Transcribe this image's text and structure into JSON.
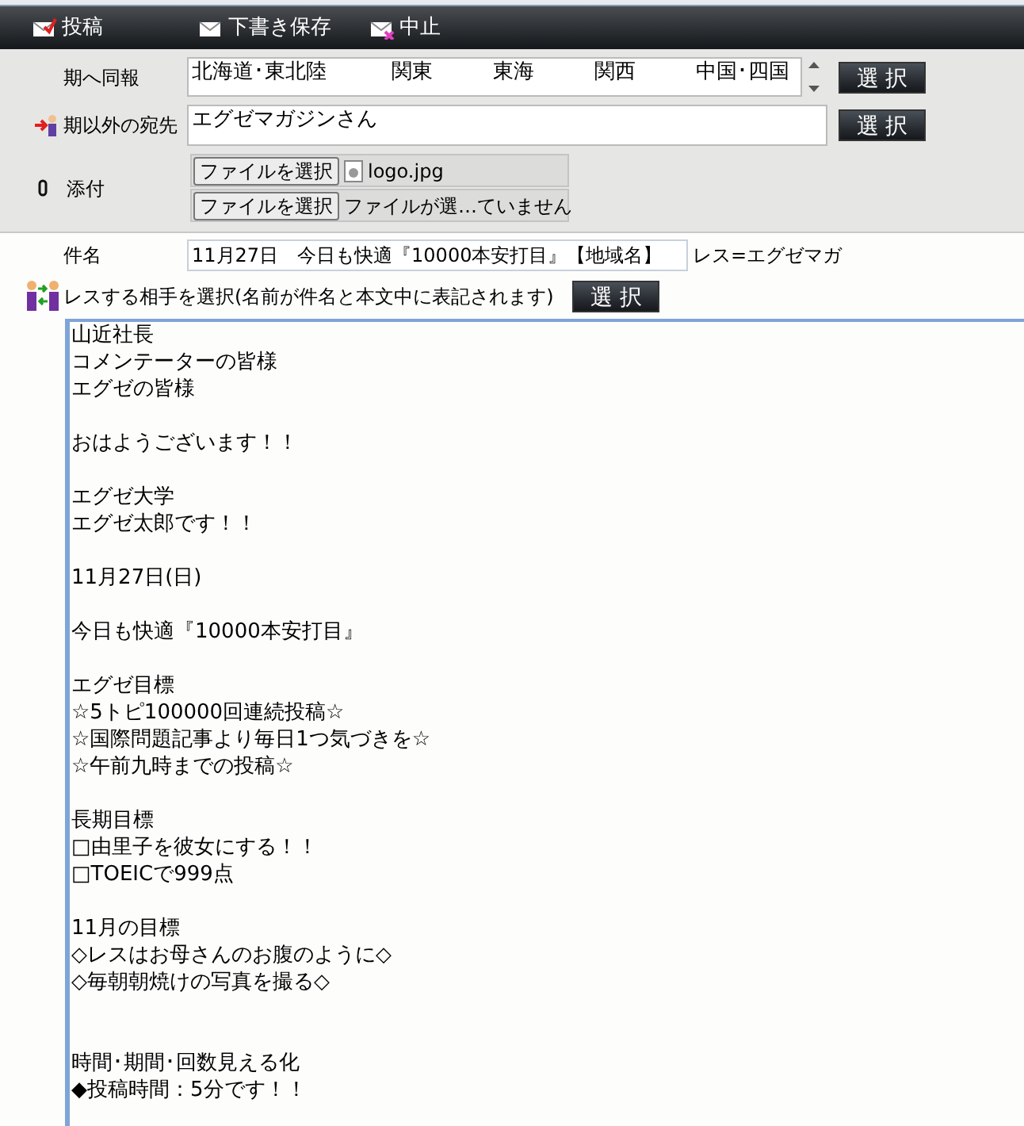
{
  "toolbar": [
    {
      "label": "投稿",
      "kind": "post"
    },
    {
      "label": "下書き保存",
      "kind": "draft"
    },
    {
      "label": "中止",
      "kind": "cancel"
    }
  ],
  "form": {
    "broadcast": {
      "label": "期へ同報",
      "options": [
        "北海道･東北陸",
        "関東",
        "東海",
        "関西",
        "中国･四国"
      ],
      "button": "選 択"
    },
    "other_recipients": {
      "label": "期以外の宛先",
      "value": "エグゼマガジンさん",
      "button": "選 択"
    },
    "attachments": {
      "label": "添付",
      "files": [
        {
          "button": "ファイルを選択",
          "name": "logo.jpg",
          "kind": "image"
        },
        {
          "button": "ファイルを選択",
          "name": "ファイルが選…ていません",
          "kind": "none"
        }
      ]
    }
  },
  "subject": {
    "label": "件名",
    "value": "11月27日　今日も快適『10000本安打目』【地域名】",
    "suffix": "レス=エグゼマガ"
  },
  "reply": {
    "label": "レスする相手を選択(名前が件名と本文中に表記されます)",
    "button": "選 択"
  },
  "body": [
    {
      "kind": "start",
      "lines": [
        "山近社長",
        "コメンテーターの皆様",
        "エグゼの皆様"
      ]
    },
    {
      "kind": "normal",
      "lines": [
        "おはようございます！！"
      ]
    },
    {
      "kind": "normal",
      "lines": [
        "エグゼ大学",
        "エグゼ太郎です！！"
      ]
    },
    {
      "kind": "normal",
      "lines": [
        "11月27日(日)"
      ]
    },
    {
      "kind": "normal",
      "lines": [
        "今日も快適『10000本安打目』"
      ]
    },
    {
      "kind": "normal",
      "lines": [
        "エグゼ目標",
        "☆5トピ100000回連続投稿☆",
        "☆国際問題記事より毎日1つ気づきを☆",
        "☆午前九時までの投稿☆"
      ]
    },
    {
      "kind": "normal",
      "lines": [
        "長期目標",
        "□由里子を彼女にする！！",
        "□TOEICで999点"
      ]
    },
    {
      "kind": "normal",
      "lines": [
        "11月の目標",
        "◇レスはお母さんのお腹のように◇",
        "◇毎朝朝焼けの写真を撮る◇"
      ]
    },
    {
      "kind": "wide",
      "lines": [
        "時間･期間･回数見える化",
        "◆投稿時間：5分です！！"
      ]
    }
  ]
}
